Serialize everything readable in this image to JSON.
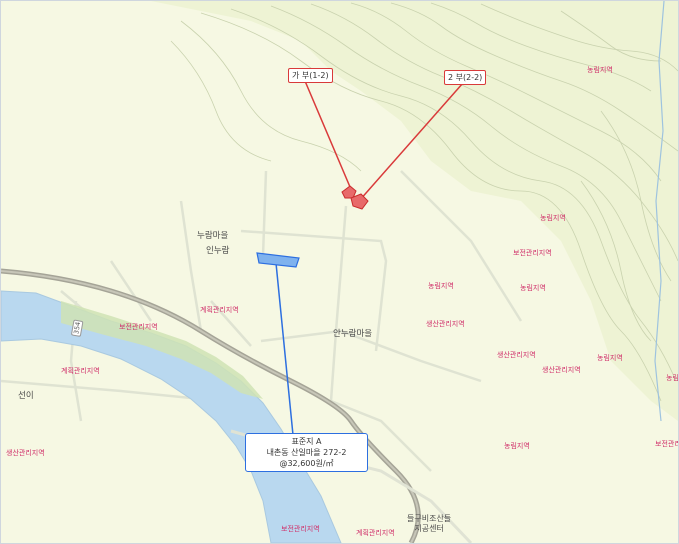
{
  "markers": {
    "red_a": "가 부(1-2)",
    "red_b": "2 부(2-2)",
    "subject": {
      "line1": "표준지 A",
      "line2": "내촌동 산일마을 272-2",
      "line3": "@32,600원/㎡"
    }
  },
  "places": {
    "nuram": "누람마을",
    "innuram": "인누람",
    "innuram_maeul": "안누람마을",
    "seoni": "선이",
    "center": "들구비조산들\n지공센터",
    "road_no": "354"
  },
  "zones": {
    "z1": "농림지역",
    "z2": "농림지역",
    "z3": "보전관리지역",
    "z4": "농림지역",
    "z5": "농림지역",
    "z6": "생산관리지역",
    "z7": "생산관리지역",
    "z8": "농림지역",
    "z9": "생산관리지역",
    "z10": "계획관리지역",
    "z11": "보전관리지역",
    "z12": "계획관리지역",
    "z13": "생산관리지역",
    "z14": "농림지역",
    "z15": "보전관리지역",
    "z16": "계획관리지역",
    "z17": "보전관리지역",
    "z18": "농림지역"
  },
  "colors": {
    "marker_red": "#d93a3a",
    "marker_blue": "#2d6fe0",
    "river": "#b9d8ef",
    "zone_text": "#d0306a"
  }
}
